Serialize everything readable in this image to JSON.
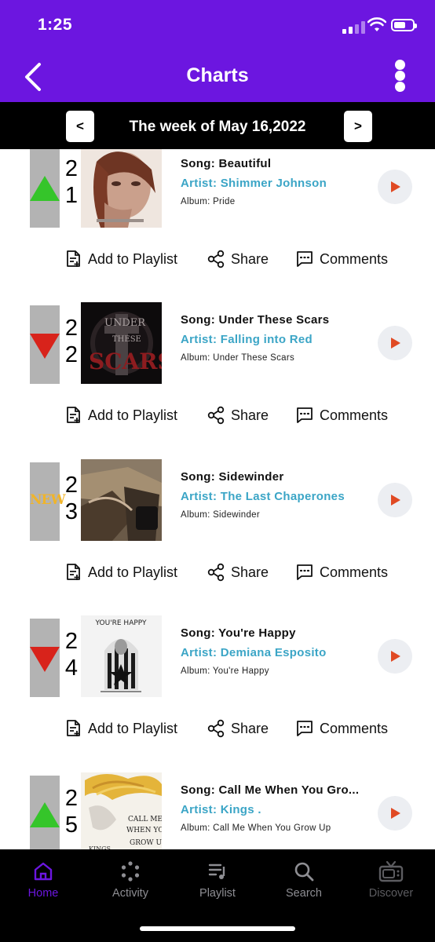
{
  "status_bar": {
    "time": "1:25"
  },
  "header": {
    "title": "Charts"
  },
  "week": {
    "prev_label": "<",
    "label": "The week of May 16,2022",
    "next_label": ">"
  },
  "entries": [
    {
      "rank_digits": [
        "2",
        "1"
      ],
      "movement": "up",
      "song": "Song: Beautiful",
      "artist": "Artist: Shimmer Johnson",
      "album": "Album: Pride"
    },
    {
      "rank_digits": [
        "2",
        "2"
      ],
      "movement": "down",
      "song": "Song: Under These Scars",
      "artist": "Artist: Falling into Red",
      "album": "Album: Under These Scars"
    },
    {
      "rank_digits": [
        "2",
        "3"
      ],
      "movement": "new",
      "badge": "NEW",
      "song": "Song: Sidewinder",
      "artist": "Artist: The Last Chaperones",
      "album": "Album: Sidewinder"
    },
    {
      "rank_digits": [
        "2",
        "4"
      ],
      "movement": "down",
      "song": "Song: You're Happy",
      "artist": "Artist: Demiana Esposito",
      "album": "Album: You're Happy"
    },
    {
      "rank_digits": [
        "2",
        "5"
      ],
      "movement": "up",
      "song": "Song: Call Me When You Gro...",
      "artist": "Artist: Kings .",
      "album": "Album: Call Me When You Grow Up"
    }
  ],
  "actions": {
    "add_to_playlist": "Add to Playlist",
    "share": "Share",
    "comments": "Comments"
  },
  "tabs": [
    {
      "label": "Home",
      "icon": "home-icon",
      "state": "active"
    },
    {
      "label": "Activity",
      "icon": "activity-icon",
      "state": "normal"
    },
    {
      "label": "Playlist",
      "icon": "playlist-icon",
      "state": "normal"
    },
    {
      "label": "Search",
      "icon": "search-icon",
      "state": "normal"
    },
    {
      "label": "Discover",
      "icon": "tv-icon",
      "state": "disabled"
    }
  ],
  "colors": {
    "accent": "#6C16E0",
    "artist": "#3ba5c6",
    "up_arrow": "#35c52a",
    "down_arrow": "#d8231b",
    "new_badge": "#f0b42a",
    "play": "#e04a24"
  }
}
